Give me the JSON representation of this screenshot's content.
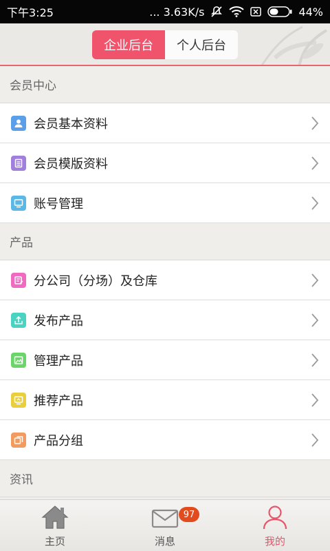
{
  "status_bar": {
    "time": "下午3:25",
    "speed": "... 3.63K/s",
    "battery": "44%"
  },
  "header": {
    "tabs": [
      {
        "label": "企业后台"
      },
      {
        "label": "个人后台"
      }
    ]
  },
  "sections": [
    {
      "title": "会员中心",
      "items": [
        {
          "label": "会员基本资料",
          "icon": "user-icon",
          "color": "#5aa0e8"
        },
        {
          "label": "会员模版资料",
          "icon": "document-icon",
          "color": "#a17fdc"
        },
        {
          "label": "账号管理",
          "icon": "monitor-icon",
          "color": "#5ab7e6"
        }
      ]
    },
    {
      "title": "产品",
      "items": [
        {
          "label": "分公司（分场）及仓库",
          "icon": "edit-icon",
          "color": "#f06bbf"
        },
        {
          "label": "发布产品",
          "icon": "upload-icon",
          "color": "#49d3c0"
        },
        {
          "label": "管理产品",
          "icon": "image-icon",
          "color": "#6cd56a"
        },
        {
          "label": "推荐产品",
          "icon": "monitor-up-icon",
          "color": "#e9cf3d"
        },
        {
          "label": "产品分组",
          "icon": "copy-icon",
          "color": "#f39a5e"
        }
      ]
    },
    {
      "title": "资讯",
      "items": []
    }
  ],
  "tabbar": {
    "home": {
      "label": "主页",
      "icon": "home-icon"
    },
    "messages": {
      "label": "消息",
      "icon": "mail-icon",
      "badge": "97"
    },
    "me": {
      "label": "我的",
      "icon": "person-icon"
    }
  },
  "colors": {
    "accent": "#f0546c",
    "badge": "#e24b1e"
  }
}
